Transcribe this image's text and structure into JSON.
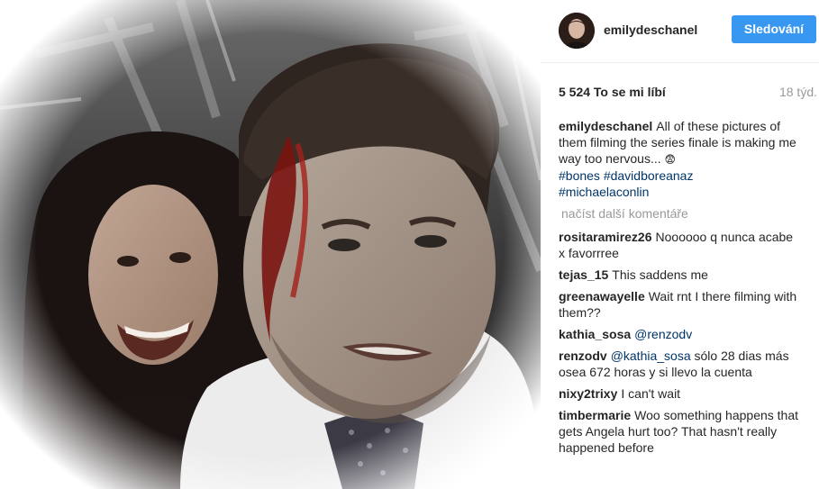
{
  "post": {
    "username": "emilydeschanel",
    "follow_label": "Sledování",
    "likes": "5 524 To se mi líbí",
    "time_ago": "18 týd."
  },
  "caption": {
    "user": "emilydeschanel",
    "text": "All of these pictures of them filming the series finale is making me way too nervous...",
    "emoji": "😨",
    "tags": [
      "#bones",
      "#davidboreanaz",
      "#michaelaconlin"
    ]
  },
  "load_more_label": "načíst další komentáře",
  "comments": [
    {
      "user": "rositaramirez26",
      "text": "Noooooo q nunca acabe x favorrree"
    },
    {
      "user": "tejas_15",
      "text": "This saddens me"
    },
    {
      "user": "greenawayelle",
      "text": "Wait rnt I there filming with them??"
    },
    {
      "user": "kathia_sosa",
      "mention": "@renzodv",
      "text": ""
    },
    {
      "user": "renzodv",
      "mention": "@kathia_sosa",
      "text": "sólo 28 dias más osea 672 horas y si llevo la cuenta"
    },
    {
      "user": "nixy2trixy",
      "text": "I can't wait"
    },
    {
      "user": "timbermarie",
      "text": "Woo something happens that gets Angela hurt too? That hasn't really happened before"
    }
  ],
  "icons": {
    "avatar": "profile-photo",
    "photo": "selfie-photo"
  },
  "colors": {
    "follow_button": "#3897f0",
    "hashtag": "#003569",
    "muted": "#999999"
  }
}
